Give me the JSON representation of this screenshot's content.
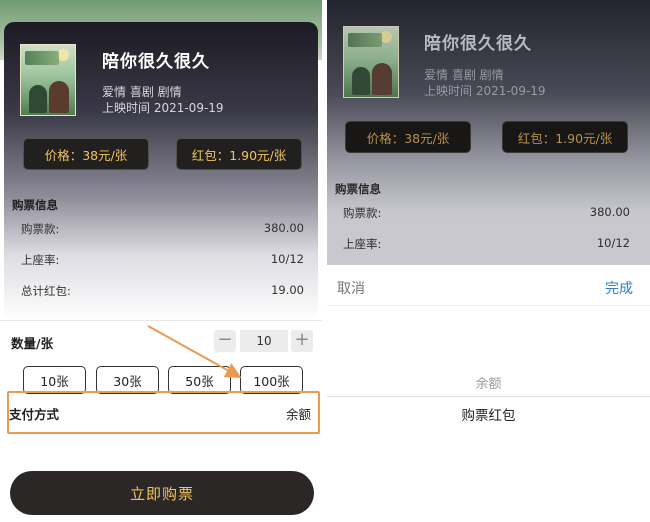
{
  "movie": {
    "title": "陪你很久很久",
    "genres": "爱情 喜剧 剧情",
    "release": "上映时间 2021-09-19"
  },
  "price_label": "价格：38元/张",
  "redpacket_label": "红包：1.90元/张",
  "purchase_info": {
    "title": "购票信息",
    "rows": [
      {
        "label": "购票款:",
        "value": "380.00"
      },
      {
        "label": "上座率:",
        "value": "10/12"
      },
      {
        "label": "总计红包:",
        "value": "19.00"
      }
    ]
  },
  "quantity": {
    "label": "数量/张",
    "minus": "−",
    "value": "10",
    "plus": "+",
    "options": [
      "10张",
      "30张",
      "50张",
      "100张"
    ]
  },
  "payment": {
    "label": "支付方式",
    "value": "余额"
  },
  "buy_button": "立即购票",
  "picker": {
    "cancel": "取消",
    "done": "完成",
    "options": [
      "余额",
      "购票红包"
    ]
  },
  "colors": {
    "accent_gold": "#f2c35f",
    "highlight_orange": "#ec9a52",
    "done_blue": "#2f7fd0"
  }
}
